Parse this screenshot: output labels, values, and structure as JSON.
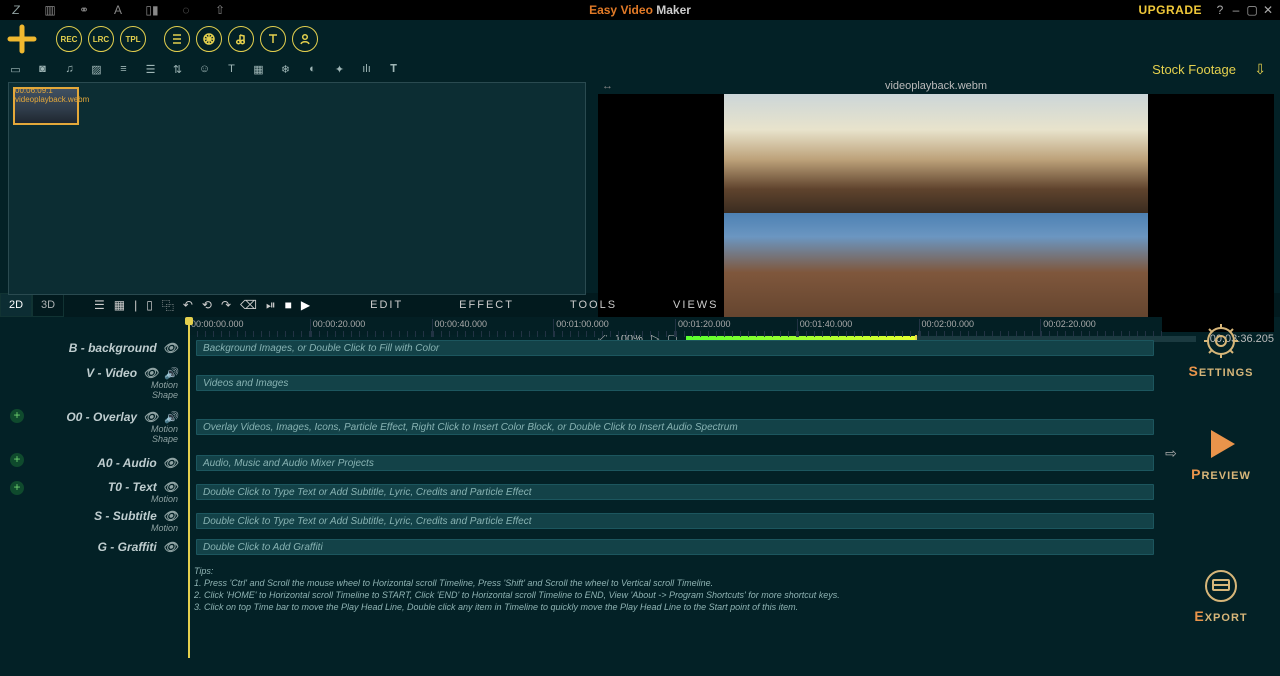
{
  "titlebar": {
    "app_pre": "Easy Video ",
    "app_suf": "Maker",
    "upgrade": "UPGRADE"
  },
  "clips": {
    "item1": {
      "time": "00:06:09.1",
      "name": "videoplayback.webm"
    }
  },
  "stock_footage": "Stock Footage",
  "circ": {
    "rec": "REC",
    "lrc": "LRC",
    "tpl": "TPL"
  },
  "preview": {
    "file": "videoplayback.webm",
    "zoom": "100%",
    "timecode": "00:03:36.205"
  },
  "modes": {
    "d2": "2D",
    "d3": "3D"
  },
  "menus": {
    "edit": "EDIT",
    "effect": "EFFECT",
    "tools": "TOOLS",
    "views": "VIEWS"
  },
  "ruler": {
    "t0": "00:00:00.000",
    "t1": "00:00:20.000",
    "t2": "00:00:40.000",
    "t3": "00:01:00.000",
    "t4": "00:01:20.000",
    "t5": "00:01:40.000",
    "t6": "00:02:00.000",
    "t7": "00:02:20.000"
  },
  "tracks": {
    "bg": {
      "label": "B - background",
      "hint": "Background Images, or Double Click to Fill with Color"
    },
    "vid": {
      "label": "V - Video",
      "hint": "Videos and Images",
      "motion": "Motion",
      "shape": "Shape"
    },
    "ov": {
      "label": "O0 - Overlay",
      "hint": "Overlay Videos, Images, Icons, Particle Effect, Right Click to Insert Color Block, or Double Click to Insert Audio Spectrum",
      "motion": "Motion",
      "shape": "Shape"
    },
    "aud": {
      "label": "A0 - Audio",
      "hint": "Audio, Music and Audio Mixer Projects"
    },
    "txt": {
      "label": "T0 - Text",
      "hint": "Double Click to Type Text or Add Subtitle, Lyric, Credits and Particle Effect",
      "motion": "Motion"
    },
    "sub": {
      "label": "S - Subtitle",
      "hint": "Double Click to Type Text or Add Subtitle, Lyric, Credits and Particle Effect",
      "motion": "Motion"
    },
    "graf": {
      "label": "G - Graffiti",
      "hint": "Double Click to Add Graffiti"
    }
  },
  "tips": {
    "head": "Tips:",
    "l1": "1. Press 'Ctrl' and Scroll the mouse wheel to Horizontal scroll Timeline, Press 'Shift' and Scroll the wheel to Vertical scroll Timeline.",
    "l2": "2. Click 'HOME' to Horizontal scroll Timeline to START, Click 'END' to Horizontal scroll Timeline to END, View 'About -> Program Shortcuts' for more shortcut keys.",
    "l3": "3. Click on top Time bar to move the Play Head Line, Double click any item in Timeline to quickly move the Play Head Line to the Start point of this item."
  },
  "right": {
    "settings": "ETTINGS",
    "settings_f": "S",
    "preview": "REVIEW",
    "preview_f": "P",
    "export": "XPORT",
    "export_f": "E"
  }
}
